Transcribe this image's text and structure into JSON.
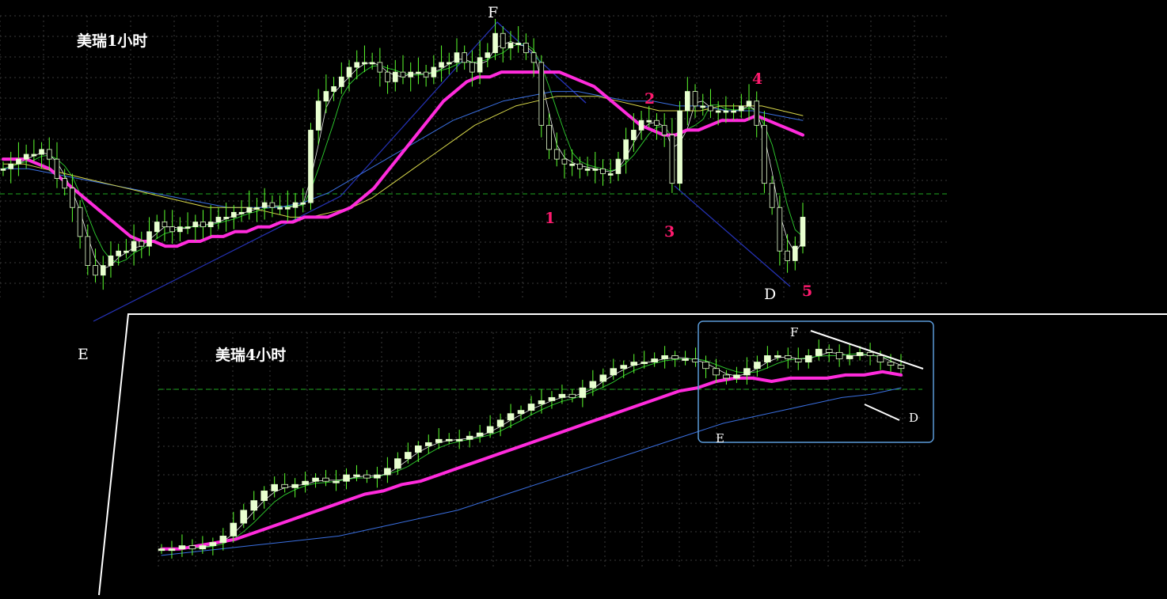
{
  "panels": [
    {
      "title": "美瑞1小时",
      "pattern_labels": {
        "E": "E",
        "F": "F",
        "D": "D"
      },
      "wave_labels": [
        "1",
        "2",
        "3",
        "4",
        "5"
      ]
    },
    {
      "title": "美瑞4小时",
      "pattern_labels": {
        "E": "E",
        "F": "F",
        "D": "D"
      }
    }
  ],
  "colors": {
    "background": "#000000",
    "candle_bull": "#e8ffd0",
    "candle_bear": "#e8ffd0",
    "wick": "#5cff2e",
    "ma_main": "#ff2bdc",
    "ma_yellow": "#d8d84a",
    "ma_blue": "#3a6fe0",
    "ma_green": "#2fd02f",
    "ma_white": "#e8e8e8",
    "trend_line": "#2633b8",
    "wave_label": "#ff1a6e",
    "separator": "#ffffff",
    "grid": "#3a3a3a",
    "level_line": "#21a821",
    "highlight_box": "#5a9ad8"
  },
  "chart_data": [
    {
      "type": "candlestick",
      "title": "美瑞1小时",
      "close_series": [
        48,
        49,
        50,
        51,
        51,
        52,
        50,
        46,
        44,
        40,
        34,
        28,
        26,
        28,
        30,
        31,
        31,
        33,
        32,
        35,
        37,
        36,
        35,
        36,
        36,
        37,
        36,
        37,
        38,
        38,
        39,
        39,
        40,
        40,
        41,
        40,
        40,
        40,
        41,
        41,
        56,
        62,
        64,
        65,
        67,
        69,
        70,
        70,
        70,
        68,
        66,
        68,
        67,
        68,
        68,
        67,
        69,
        70,
        70,
        72,
        70,
        68,
        71,
        72,
        76,
        73,
        74,
        74,
        72,
        70,
        57,
        52,
        50,
        49,
        49,
        48,
        48,
        48,
        47,
        47,
        50,
        54,
        56,
        58,
        58,
        57,
        55,
        45,
        60,
        64,
        61,
        61,
        60,
        60,
        60,
        60,
        61,
        62,
        57,
        45,
        40,
        31,
        29,
        32,
        38
      ],
      "ma_main_series": [
        50,
        50,
        50,
        49,
        48,
        46,
        44,
        42,
        40,
        38,
        36,
        34,
        33,
        33,
        32,
        32,
        33,
        33,
        34,
        34,
        35,
        35,
        36,
        36,
        37,
        37,
        38,
        38,
        38,
        39,
        40,
        42,
        44,
        47,
        50,
        53,
        56,
        59,
        62,
        64,
        66,
        67,
        67,
        68,
        68,
        68,
        68,
        68,
        68,
        67,
        66,
        65,
        63,
        61,
        59,
        57,
        56,
        55,
        55,
        56,
        56,
        57,
        58,
        58,
        58,
        59,
        58,
        57,
        56,
        55
      ],
      "ma_yellow_series": [
        49,
        49,
        48,
        47,
        46,
        45,
        44,
        43,
        42,
        41,
        40,
        40,
        40,
        39,
        38,
        38,
        39,
        40,
        42,
        45,
        48,
        51,
        54,
        57,
        59,
        61,
        62,
        63,
        63,
        63,
        62,
        61,
        60,
        60,
        60,
        61,
        61,
        61,
        60,
        59
      ],
      "ma_blue_series": [
        48,
        48,
        47,
        46,
        45,
        44,
        43,
        42,
        41,
        40,
        40,
        40,
        41,
        43,
        46,
        49,
        52,
        55,
        58,
        60,
        62,
        63,
        64,
        64,
        63,
        62,
        62,
        61,
        61,
        60,
        60,
        59,
        58
      ]
    },
    {
      "type": "candlestick",
      "title": "美瑞4小时",
      "close_series": [
        10,
        10,
        11,
        10,
        11,
        12,
        14,
        18,
        22,
        25,
        28,
        30,
        29,
        30,
        31,
        32,
        31,
        31,
        33,
        33,
        32,
        33,
        35,
        38,
        40,
        42,
        43,
        44,
        44,
        44,
        45,
        46,
        48,
        50,
        52,
        53,
        55,
        56,
        57,
        58,
        57,
        60,
        62,
        64,
        66,
        67,
        68,
        68,
        69,
        70,
        69,
        69,
        68,
        66,
        64,
        63,
        64,
        66,
        68,
        70,
        70,
        69,
        68,
        70,
        72,
        71,
        69,
        70,
        71,
        70,
        68,
        67,
        66
      ],
      "ma_main_series": [
        10,
        10,
        11,
        12,
        13,
        15,
        17,
        19,
        21,
        23,
        25,
        27,
        28,
        30,
        31,
        33,
        35,
        37,
        39,
        41,
        43,
        45,
        47,
        49,
        51,
        53,
        55,
        57,
        59,
        60,
        62,
        63,
        63,
        62,
        63,
        63,
        63,
        64,
        64,
        65,
        64
      ],
      "ma_blue_series": [
        8,
        9,
        10,
        11,
        12,
        13,
        14,
        16,
        18,
        20,
        22,
        25,
        28,
        31,
        34,
        37,
        40,
        43,
        46,
        49,
        51,
        53,
        55,
        57,
        58,
        60
      ]
    }
  ]
}
